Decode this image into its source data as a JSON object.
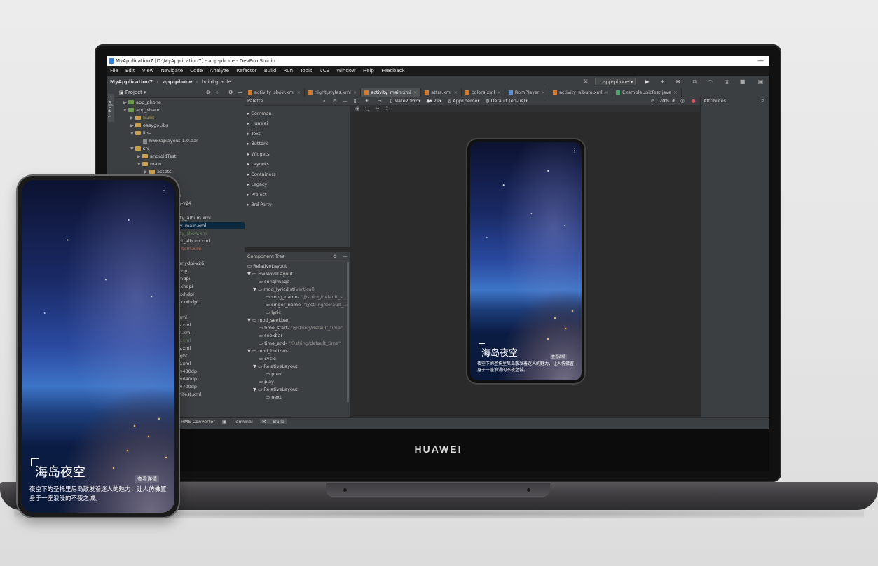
{
  "ide": {
    "title": "MyApplication7 [D:\\MyApplication7] - app-phone - DevEco Studio",
    "window_controls": "—",
    "menu": [
      "File",
      "Edit",
      "View",
      "Navigate",
      "Code",
      "Analyze",
      "Refactor",
      "Build",
      "Run",
      "Tools",
      "VCS",
      "Window",
      "Help",
      "Feedback"
    ],
    "breadcrumb": [
      "MyApplication7",
      "app-phone",
      "build.gradle"
    ],
    "run_config": "app-phone",
    "project_label": "1: Project",
    "project_header": "Project",
    "project_tree": [
      {
        "label": "app_phone",
        "level": 1,
        "type": "folder"
      },
      {
        "label": "app_share",
        "level": 1,
        "type": "folder"
      },
      {
        "label": "build",
        "level": 2,
        "type": "folder"
      },
      {
        "label": "easygoLibs",
        "level": 2,
        "type": "folder"
      },
      {
        "label": "libs",
        "level": 2,
        "type": "folder"
      },
      {
        "label": "hwxraplayout-1.0.aar",
        "level": 3,
        "type": "file"
      },
      {
        "label": "src",
        "level": 2,
        "type": "folder"
      },
      {
        "label": "androidTest",
        "level": 3,
        "type": "folder"
      },
      {
        "label": "main",
        "level": 3,
        "type": "folder"
      },
      {
        "label": "assets",
        "level": 4,
        "type": "folder"
      }
    ],
    "project_tree_partial": [
      "e",
      "e-v24",
      "ity_album.xml",
      "ly_main.xml",
      "ity_show.xml",
      "nt_album.xml",
      "_item.xml",
      "anydpi-v26",
      "hdpi",
      "mdpi",
      "-xhdpi",
      "xxhdpi",
      "-xxxhdpi",
      "xml",
      "s.xml",
      "n.xml",
      "s.xml",
      "s.xml",
      "ight",
      "s.xml",
      "w480dp",
      "w640dp",
      "w700dp",
      "nifest.xml"
    ],
    "tabs": [
      {
        "label": "activity_show.xml",
        "active": false
      },
      {
        "label": "night\\styles.xml",
        "active": false
      },
      {
        "label": "activity_main.xml",
        "active": true
      },
      {
        "label": "attrs.xml",
        "active": false
      },
      {
        "label": "colors.xml",
        "active": false
      },
      {
        "label": "RomPlayer",
        "active": false
      },
      {
        "label": "activity_album.xml",
        "active": false
      },
      {
        "label": "ExampleUnitTest.java",
        "active": false
      }
    ],
    "palette_header": "Palette",
    "palette": [
      "Common",
      "Huawei",
      "Text",
      "Buttons",
      "Widgets",
      "Layouts",
      "Containers",
      "Legacy",
      "Project",
      "3rd Party"
    ],
    "component_tree_header": "Component Tree",
    "component_tree": [
      {
        "label": "RelativeLayout",
        "attr": "",
        "level": 0
      },
      {
        "label": "HwMoveLayout",
        "attr": "",
        "level": 1
      },
      {
        "label": "songImage",
        "attr": "",
        "level": 2
      },
      {
        "label": "mod_lyricdist",
        "attr": "(vertical)",
        "level": 2
      },
      {
        "label": "song_name-",
        "attr": "\"@string/default_s...",
        "level": 3
      },
      {
        "label": "singer_name-",
        "attr": "\"@string/default_...",
        "level": 3
      },
      {
        "label": "lyric",
        "attr": "",
        "level": 3
      },
      {
        "label": "mod_seekbar",
        "attr": "",
        "level": 1
      },
      {
        "label": "time_start-",
        "attr": "\"@string/default_time\"",
        "level": 2
      },
      {
        "label": "seekbar",
        "attr": "",
        "level": 2
      },
      {
        "label": "time_end-",
        "attr": "\"@string/default_time\"",
        "level": 2
      },
      {
        "label": "mod_buttons",
        "attr": "",
        "level": 1
      },
      {
        "label": "cycle",
        "attr": "",
        "level": 2
      },
      {
        "label": "RelativeLayout",
        "attr": "",
        "level": 2
      },
      {
        "label": "prev",
        "attr": "",
        "level": 3
      },
      {
        "label": "play",
        "attr": "",
        "level": 2
      },
      {
        "label": "RelativeLayout",
        "attr": "",
        "level": 2
      },
      {
        "label": "next",
        "attr": "",
        "level": 3
      }
    ],
    "design_toolbar": {
      "device": "Mate20Pro",
      "api": "29",
      "theme": "AppTheme",
      "locale": "Default (en-us)",
      "zoom": "20%"
    },
    "attributes_header": "Attributes",
    "bottom_tabs": [
      "HMS Convertor",
      "Terminal",
      "Build"
    ]
  },
  "laptop_brand": "HUAWEI",
  "content": {
    "title": "海岛夜空",
    "tag": "查看详情",
    "description": "夜空下的圣托里尼岛散发着迷人的魅力，让人仿佛置身于一座浪漫的不夜之城。",
    "menu_glyph": "⋮"
  }
}
